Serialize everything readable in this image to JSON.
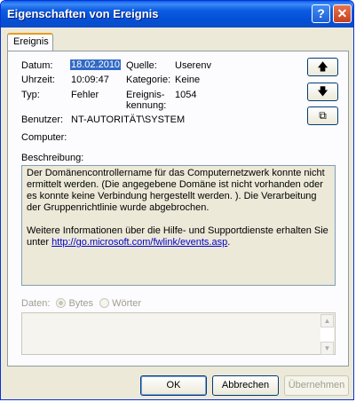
{
  "window": {
    "title": "Eigenschaften von Ereignis",
    "help_glyph": "?",
    "close_glyph": "✕"
  },
  "tabs": [
    {
      "label": "Ereignis",
      "active": true
    }
  ],
  "event": {
    "date_label": "Datum:",
    "date": "18.02.2010",
    "time_label": "Uhrzeit:",
    "time": "10:09:47",
    "type_label": "Typ:",
    "type": "Fehler",
    "user_label": "Benutzer:",
    "user": "NT-AUTORITÄT\\SYSTEM",
    "computer_label": "Computer:",
    "computer": "",
    "source_label": "Quelle:",
    "source": "Userenv",
    "category_label": "Kategorie:",
    "category": "Keine",
    "event_id_label_1": "Ereignis-",
    "event_id_label_2": "kennung:",
    "event_id": "1054"
  },
  "side_buttons": {
    "up": "🡅",
    "down": "🡇",
    "copy": "⧉"
  },
  "description": {
    "label": "Beschreibung:",
    "paragraph1": "Der Domänencontrollername für das Computernetzwerk konnte nicht ermittelt werden. (Die angegebene Domäne ist nicht vorhanden oder es konnte keine Verbindung hergestellt werden. ). Die Verarbeitung der Gruppenrichtlinie wurde abgebrochen.",
    "paragraph2_prefix": "Weitere Informationen über die Hilfe- und Supportdienste erhalten Sie unter ",
    "link": "http://go.microsoft.com/fwlink/events.asp",
    "paragraph2_suffix": "."
  },
  "data": {
    "label": "Daten:",
    "option_bytes": "Bytes",
    "option_words": "Wörter",
    "selected": "Bytes"
  },
  "buttons": {
    "ok": "OK",
    "cancel": "Abbrechen",
    "apply": "Übernehmen"
  }
}
